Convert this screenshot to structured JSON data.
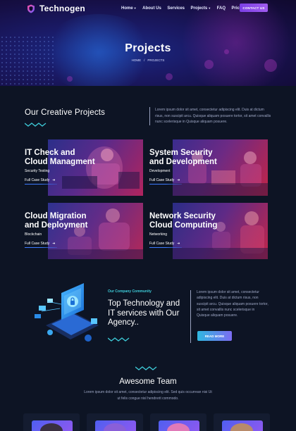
{
  "brand": {
    "name": "Technogen"
  },
  "nav": {
    "items": [
      {
        "label": "Home",
        "dropdown": true
      },
      {
        "label": "About Us",
        "dropdown": false
      },
      {
        "label": "Services",
        "dropdown": false
      },
      {
        "label": "Projects",
        "dropdown": true
      },
      {
        "label": "FAQ",
        "dropdown": false
      },
      {
        "label": "Pricing",
        "dropdown": false
      }
    ],
    "contact_label": "CONTACT US"
  },
  "hero": {
    "title": "Projects",
    "breadcrumb": [
      "HOME",
      "/",
      "PROJECTS"
    ]
  },
  "intro": {
    "title": "Our Creative Projects",
    "text": "Lorem ipsum dolor sit amet, consectetur adipiscing elit. Duis at dictum risus, non suscipit arcu. Quisque aliquam posuere tortor, sit amet convallis nunc scelerisque in Quisque aliquam posuere."
  },
  "projects": [
    {
      "title_line1": "IT Check and",
      "title_line2": "Cloud Managment",
      "tag": "Security Testing",
      "link": "Full Case Study"
    },
    {
      "title_line1": "System Security",
      "title_line2": "and Development",
      "tag": "Development",
      "link": "Full Case Study"
    },
    {
      "title_line1": "Cloud Migration",
      "title_line2": "and Deployment",
      "tag": "Blockchain",
      "link": "Full Case Study"
    },
    {
      "title_line1": "Network Security",
      "title_line2": "Cloud Computing",
      "tag": "Networking",
      "link": "Full Case Study"
    }
  ],
  "community": {
    "label": "Our Company Community",
    "title": "Top Technology and IT services with Our Agency..",
    "text": "Lorem ipsum dolor sit amet, consectetur adipiscing elit. Duis at dictum risus, non suscipit arcu. Quisque aliquam posuere tortor, sit amet convallis nunc scelerisque in Quisque aliquam posuere.",
    "button": "READ MORE"
  },
  "team": {
    "title": "Awesome Team",
    "text": "Lorem ipsum dolor sit amet, consectetur adipiscing elit. Sed quis occurrean nisi Ut ut felis congue nisl hendrerit commodo."
  },
  "colors": {
    "page_bg": "#0d1424",
    "accent_purple": "#8b4aee",
    "accent_cyan": "#3ecbd8",
    "link_underline": "#3c7bff"
  }
}
